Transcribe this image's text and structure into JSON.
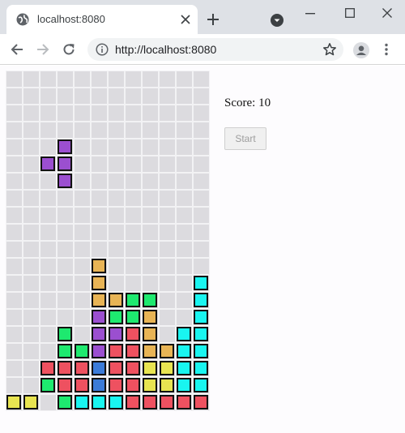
{
  "browser": {
    "tab_title": "localhost:8080",
    "url": "http://localhost:8080"
  },
  "game": {
    "score_label": "Score: 10",
    "start_label": "Start",
    "start_enabled": false,
    "board_cols": 12,
    "board_rows": 20,
    "colors": {
      "Y": "#e8e451",
      "C": "#19f5f0",
      "G": "#1ee96f",
      "R": "#ee5160",
      "B": "#3b7bd8",
      "P": "#9b4fd0",
      "O": "#e8b455"
    },
    "active_piece": {
      "color": "P",
      "cells": [
        [
          3,
          4
        ],
        [
          2,
          5
        ],
        [
          3,
          5
        ],
        [
          3,
          6
        ]
      ]
    },
    "locked_rows": [
      "............",
      "............",
      "............",
      "............",
      "............",
      "............",
      "............",
      "............",
      "............",
      "............",
      "............",
      ".....O......",
      ".....O.....C",
      ".....OOGG..C",
      ".....PGGO..C",
      "...G.PPRO.CC",
      "...GGPRROOCC",
      "..RRRBRRYYCC",
      "..GRRBRRYYCC",
      "YY.GCCCRRRRR"
    ]
  }
}
